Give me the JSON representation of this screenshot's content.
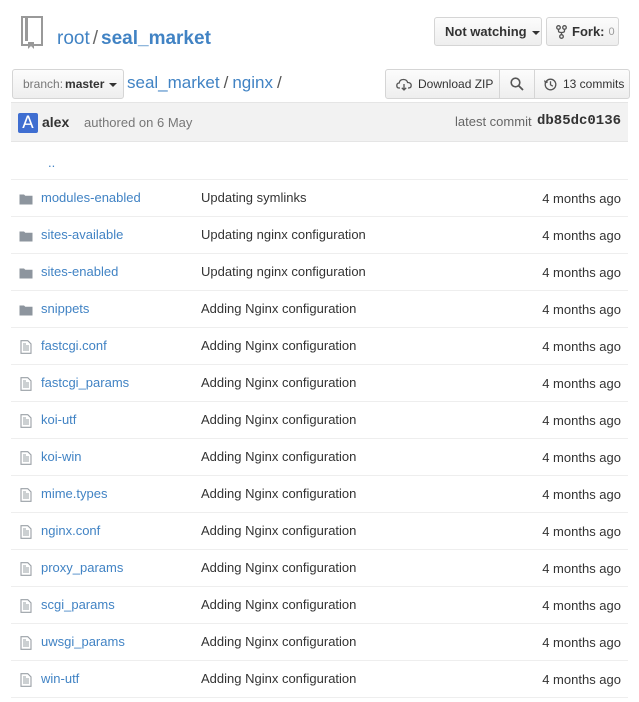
{
  "repo": {
    "owner": "root",
    "separator": "/",
    "name": "seal_market"
  },
  "actions": {
    "watch_label": "Not watching",
    "fork_label": "Fork:",
    "fork_count": "0"
  },
  "branch": {
    "prefix": "branch:",
    "name": "master"
  },
  "path": {
    "crumbs": [
      "seal_market",
      "nginx"
    ],
    "separator": "/"
  },
  "toolbar": {
    "download_label": "Download ZIP",
    "commits_label": "13 commits"
  },
  "latest_commit": {
    "author": "alex",
    "avatar_letter": "A",
    "authored_text": "authored on 6 May",
    "latest_label": "latest commit",
    "sha": "db85dc0136"
  },
  "parent_link": "..",
  "files": [
    {
      "type": "dir",
      "name": "modules-enabled",
      "message": "Updating symlinks",
      "age": "4 months ago"
    },
    {
      "type": "dir",
      "name": "sites-available",
      "message": "Updating nginx configuration",
      "age": "4 months ago"
    },
    {
      "type": "dir",
      "name": "sites-enabled",
      "message": "Updating nginx configuration",
      "age": "4 months ago"
    },
    {
      "type": "dir",
      "name": "snippets",
      "message": "Adding Nginx configuration",
      "age": "4 months ago"
    },
    {
      "type": "file",
      "name": "fastcgi.conf",
      "message": "Adding Nginx configuration",
      "age": "4 months ago"
    },
    {
      "type": "file",
      "name": "fastcgi_params",
      "message": "Adding Nginx configuration",
      "age": "4 months ago"
    },
    {
      "type": "file",
      "name": "koi-utf",
      "message": "Adding Nginx configuration",
      "age": "4 months ago"
    },
    {
      "type": "file",
      "name": "koi-win",
      "message": "Adding Nginx configuration",
      "age": "4 months ago"
    },
    {
      "type": "file",
      "name": "mime.types",
      "message": "Adding Nginx configuration",
      "age": "4 months ago"
    },
    {
      "type": "file",
      "name": "nginx.conf",
      "message": "Adding Nginx configuration",
      "age": "4 months ago"
    },
    {
      "type": "file",
      "name": "proxy_params",
      "message": "Adding Nginx configuration",
      "age": "4 months ago"
    },
    {
      "type": "file",
      "name": "scgi_params",
      "message": "Adding Nginx configuration",
      "age": "4 months ago"
    },
    {
      "type": "file",
      "name": "uwsgi_params",
      "message": "Adding Nginx configuration",
      "age": "4 months ago"
    },
    {
      "type": "file",
      "name": "win-utf",
      "message": "Adding Nginx configuration",
      "age": "4 months ago"
    }
  ],
  "icons": {
    "repo": "repo-icon",
    "dir": "folder-icon",
    "file": "file-text-icon",
    "download": "cloud-download-icon",
    "search": "search-icon",
    "history": "history-icon",
    "fork": "fork-icon"
  },
  "colors": {
    "link": "#4183c4",
    "avatar": "#3f6ed1"
  }
}
